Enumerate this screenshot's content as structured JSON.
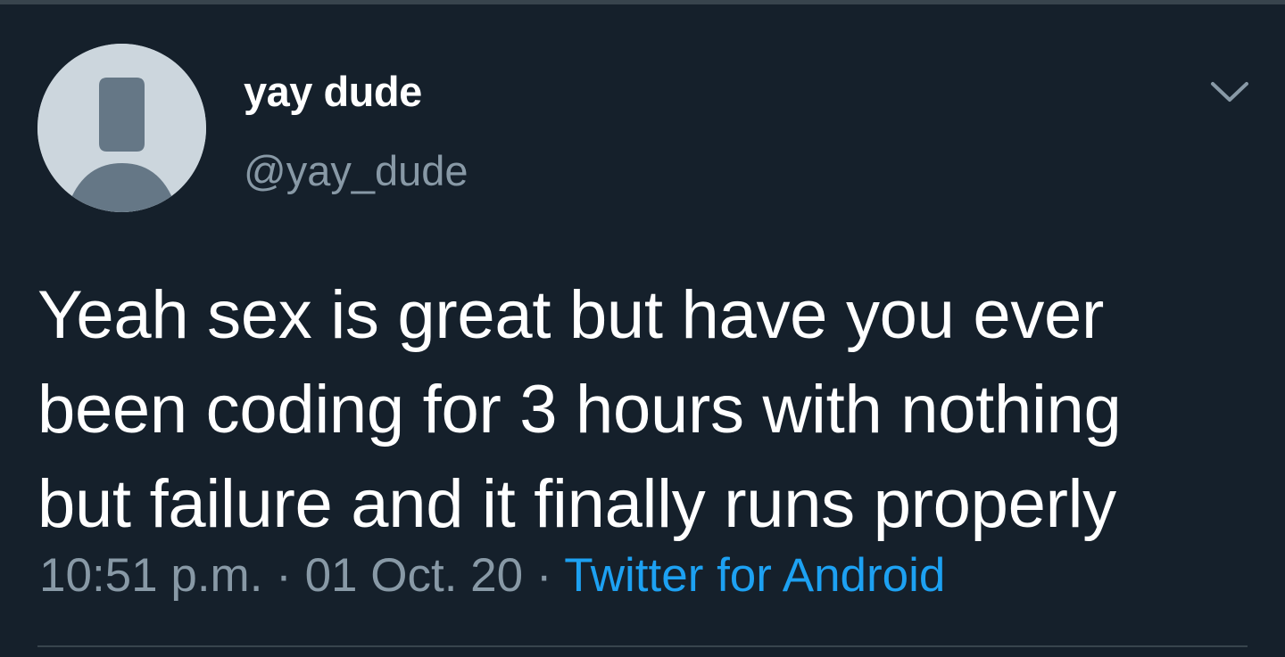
{
  "user": {
    "display_name": "yay dude",
    "handle": "@yay_dude",
    "avatar_icon": "default-profile-icon"
  },
  "menu": {
    "icon": "chevron-down-icon"
  },
  "tweet": {
    "text": "Yeah sex is great but have you ever\nbeen coding for 3 hours with nothing\nbut failure and it finally runs properly",
    "time": "10:51 p.m.",
    "separator": "·",
    "date": "01 Oct. 20",
    "source": "Twitter for Android"
  },
  "colors": {
    "background": "#15202b",
    "text": "#ffffff",
    "secondary_text": "#8899a6",
    "link": "#1da1f2",
    "divider": "#38444d",
    "avatar_bg": "#ccd6dd",
    "avatar_figure": "#657786"
  }
}
